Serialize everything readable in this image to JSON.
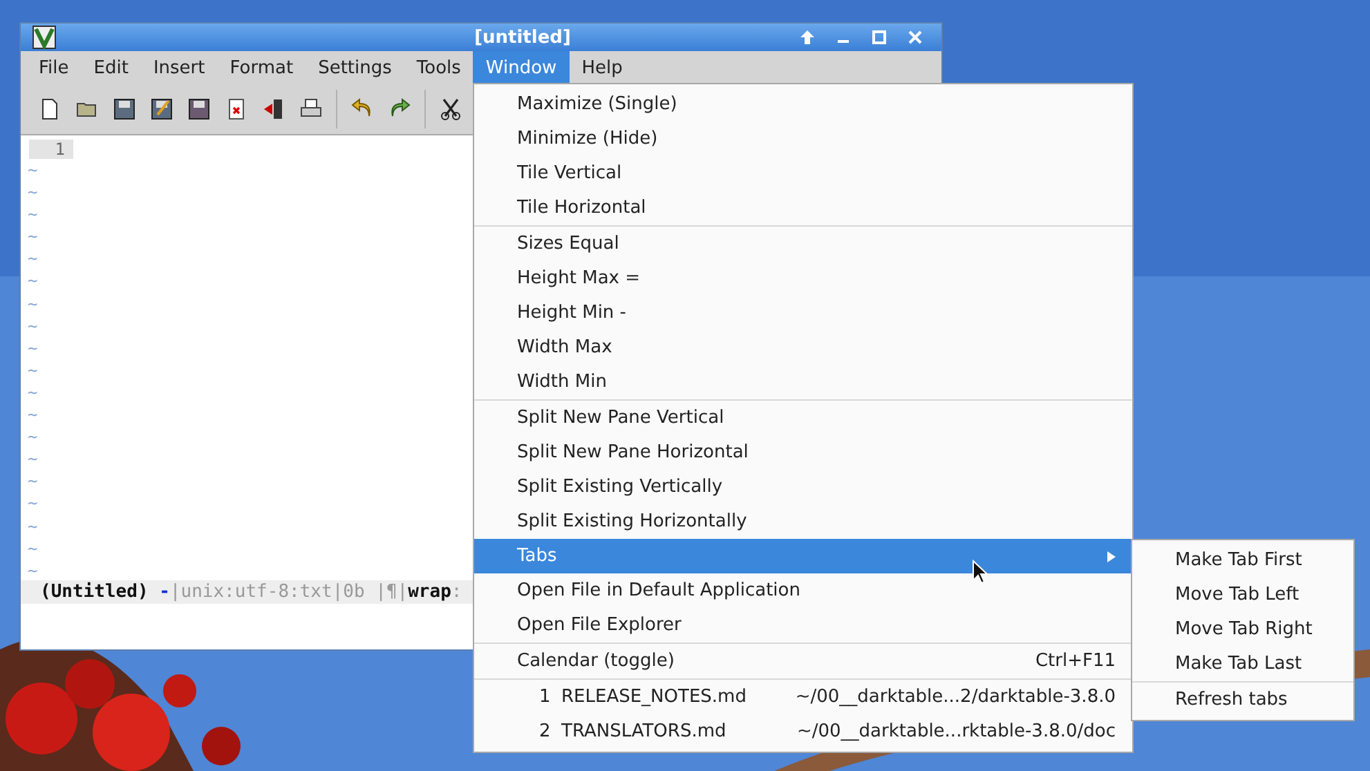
{
  "window": {
    "title": "[untitled]"
  },
  "menubar": [
    {
      "label": "File",
      "selected": false
    },
    {
      "label": "Edit",
      "selected": false
    },
    {
      "label": "Insert",
      "selected": false
    },
    {
      "label": "Format",
      "selected": false
    },
    {
      "label": "Settings",
      "selected": false
    },
    {
      "label": "Tools",
      "selected": false
    },
    {
      "label": "Window",
      "selected": true
    },
    {
      "label": "Help",
      "selected": false
    }
  ],
  "editor": {
    "line_number": "1",
    "tildes": [
      "~",
      "~",
      "~",
      "~",
      "~",
      "~",
      "~",
      "~",
      "~",
      "~",
      "~",
      "~",
      "~",
      "~",
      "~",
      "~",
      "~",
      "~",
      "~"
    ]
  },
  "status_line": [
    {
      "kind": "bold",
      "text": "(Untitled) "
    },
    {
      "kind": "mark",
      "text": "-"
    },
    {
      "kind": "dim",
      "text": "|unix:utf-8:txt|0b |¶|"
    },
    {
      "kind": "bold",
      "text": "wrap"
    },
    {
      "kind": "dim",
      "text": ":"
    }
  ],
  "window_menu": [
    {
      "kind": "item",
      "label": "Maximize (Single)"
    },
    {
      "kind": "item",
      "label": "Minimize (Hide)"
    },
    {
      "kind": "item",
      "label": "Tile Vertical"
    },
    {
      "kind": "item",
      "label": "Tile Horizontal"
    },
    {
      "kind": "separator"
    },
    {
      "kind": "item",
      "label": "Sizes Equal"
    },
    {
      "kind": "item",
      "label": "Height Max ="
    },
    {
      "kind": "item",
      "label": "Height Min -"
    },
    {
      "kind": "item",
      "label": "Width Max"
    },
    {
      "kind": "item",
      "label": "Width Min"
    },
    {
      "kind": "separator"
    },
    {
      "kind": "item",
      "label": "Split New Pane Vertical"
    },
    {
      "kind": "item",
      "label": "Split New Pane Horizontal"
    },
    {
      "kind": "item",
      "label": "Split Existing Vertically"
    },
    {
      "kind": "item",
      "label": "Split Existing Horizontally"
    },
    {
      "kind": "submenu",
      "label": "Tabs",
      "selected": true
    },
    {
      "kind": "item",
      "label": "Open File in Default Application"
    },
    {
      "kind": "item",
      "label": "Open File Explorer"
    },
    {
      "kind": "separator"
    },
    {
      "kind": "item",
      "label": "Calendar (toggle)",
      "shortcut": "Ctrl+F11"
    },
    {
      "kind": "separator"
    },
    {
      "kind": "file",
      "number": "1",
      "label": "RELEASE_NOTES.md",
      "path": "~/00__darktable...2/darktable-3.8.0"
    },
    {
      "kind": "file",
      "number": "2",
      "label": "TRANSLATORS.md",
      "path": "~/00__darktable...rktable-3.8.0/doc"
    }
  ],
  "tabs_submenu": [
    {
      "kind": "item",
      "label": "Make Tab First"
    },
    {
      "kind": "item",
      "label": "Move Tab Left"
    },
    {
      "kind": "item",
      "label": "Move Tab Right"
    },
    {
      "kind": "item",
      "label": "Make Tab Last"
    },
    {
      "kind": "separator"
    },
    {
      "kind": "item",
      "label": "Refresh tabs"
    }
  ]
}
